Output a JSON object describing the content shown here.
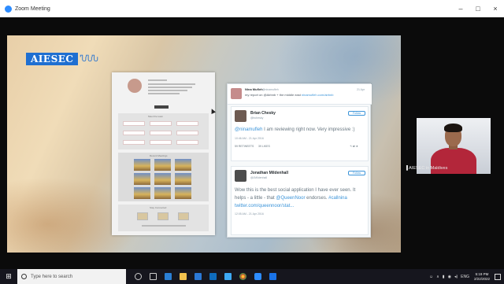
{
  "window": {
    "title": "Zoom Meeting",
    "controls": [
      "–",
      "□",
      "×"
    ]
  },
  "share": {
    "logo_text": "AIESEC",
    "site": {
      "caption_1": "Meet the team",
      "caption_2": "Recent Meetings",
      "caption_3": "Stay Connected"
    },
    "tweets": {
      "top": {
        "name": "Nina Mufleh",
        "handle": "@ninamufleh",
        "time": "21 Apr",
        "text": "my report on @Airbnb + the middle east ",
        "link": "ninamufleh.com/airbnb"
      },
      "chesky": {
        "name": "Brian Chesky",
        "handle": "@bchesky",
        "follow": "Follow",
        "mention": "@ninamufleh",
        "text": " I am reviewing right now. Very impressive :)",
        "meta": "10:46 AM - 21 Apr 2016",
        "retweets": "59 RETWEETS",
        "likes": "39 LIKES"
      },
      "mildenhall": {
        "name": "Jonathan Mildenhall",
        "handle": "@JMildenhall",
        "follow": "Follow",
        "text_1": "Wow this is the best social application I have ever seen. It",
        "text_2": "helps - a little - that ",
        "mention": "@QueenNoor",
        "text_3": " endorses. ",
        "hashtag": "#callnina",
        "link": "twitter.com/queennoor/stat...",
        "meta": "12:05 AM - 21 Apr 2016"
      }
    }
  },
  "participant": {
    "name": "AIESEC in Maldives"
  },
  "taskbar": {
    "search_placeholder": "Type here to search",
    "tray": {
      "lang": "ENG",
      "time": "5:19 PM",
      "date": "2/22/2022"
    }
  },
  "colors": {
    "accent": "#2d8cff",
    "aiesec_blue": "#1f6fd1",
    "twitter_blue": "#3b94d9"
  }
}
